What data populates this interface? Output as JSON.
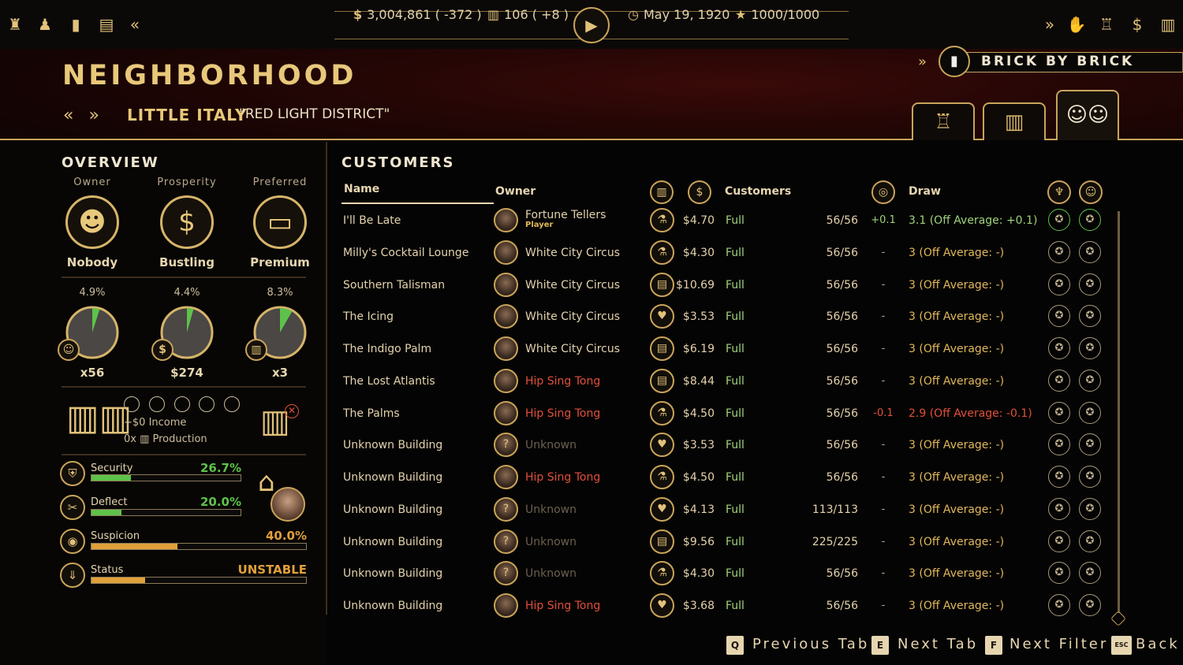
{
  "topbar": {
    "money": "3,004,861 ( -372 )",
    "booze": "106 ( +8 )",
    "date": "May 19, 1920",
    "score": "1000/1000",
    "icons_left": [
      "bodyguard-icon",
      "crew-icon",
      "ledger-icon",
      "briefcase-icon",
      "collapse-left-icon"
    ],
    "icons_right": [
      "expand-right-icon",
      "handshake-icon",
      "city-icon",
      "dollar-icon",
      "booze-crate-icon"
    ]
  },
  "header": {
    "title": "NEIGHBORHOOD",
    "district": "LITTLE ITALY",
    "district_nick": "\"RED LIGHT DISTRICT\"",
    "book": "BRICK BY BRICK"
  },
  "overview": {
    "title": "OVERVIEW",
    "owner_label": "Owner",
    "owner_value": "Nobody",
    "prosperity_label": "Prosperity",
    "prosperity_value": "Bustling",
    "preferred_label": "Preferred",
    "preferred_value": "Premium",
    "gauges": [
      {
        "pct_label": "4.9%",
        "fraction": 0.049,
        "value": "x56",
        "icon": "customers-icon"
      },
      {
        "pct_label": "4.4%",
        "fraction": 0.044,
        "value": "$274",
        "icon": "money-icon"
      },
      {
        "pct_label": "8.3%",
        "fraction": 0.083,
        "value": "x3",
        "icon": "building-icon"
      }
    ],
    "income": "+$0 Income",
    "production": "0x ▥ Production",
    "stats": [
      {
        "label": "Security",
        "value": "26.7%",
        "fraction": 0.267,
        "color": "#5ec24a"
      },
      {
        "label": "Deflect",
        "value": "20.0%",
        "fraction": 0.2,
        "color": "#5ec24a"
      },
      {
        "label": "Suspicion",
        "value": "40.0%",
        "fraction": 0.4,
        "color": "#e0a03a"
      },
      {
        "label": "Status",
        "value": "UNSTABLE",
        "fraction": 0.25,
        "color": "#e0a03a"
      }
    ]
  },
  "customers": {
    "title": "CUSTOMERS",
    "columns": {
      "name": "Name",
      "owner": "Owner",
      "customers": "Customers",
      "draw": "Draw"
    },
    "rows": [
      {
        "name": "I'll Be Late",
        "owner": "Fortune Tellers",
        "sub": "Player",
        "owner_color": "#e3d3ad",
        "price": "$4.70",
        "status": "Full",
        "count": "56/56",
        "mod": "+0.1",
        "mod_color": "#9ed27a",
        "draw": "3.1 (Off Average: +0.1)",
        "draw_color": "#9ed27a"
      },
      {
        "name": "Milly's Cocktail Lounge",
        "owner": "White City Circus",
        "sub": "",
        "owner_color": "#e3d3ad",
        "price": "$4.30",
        "status": "Full",
        "count": "56/56",
        "mod": "-",
        "mod_color": "#bcae8c",
        "draw": "3 (Off Average: -)",
        "draw_color": "#e0b85a"
      },
      {
        "name": "Southern Talisman",
        "owner": "White City Circus",
        "sub": "",
        "owner_color": "#e3d3ad",
        "price": "$10.69",
        "status": "Full",
        "count": "56/56",
        "mod": "-",
        "mod_color": "#bcae8c",
        "draw": "3 (Off Average: -)",
        "draw_color": "#e0b85a"
      },
      {
        "name": "The Icing",
        "owner": "White City Circus",
        "sub": "",
        "owner_color": "#e3d3ad",
        "price": "$3.53",
        "status": "Full",
        "count": "56/56",
        "mod": "-",
        "mod_color": "#bcae8c",
        "draw": "3 (Off Average: -)",
        "draw_color": "#e0b85a"
      },
      {
        "name": "The Indigo Palm",
        "owner": "White City Circus",
        "sub": "",
        "owner_color": "#e3d3ad",
        "price": "$6.19",
        "status": "Full",
        "count": "56/56",
        "mod": "-",
        "mod_color": "#bcae8c",
        "draw": "3 (Off Average: -)",
        "draw_color": "#e0b85a"
      },
      {
        "name": "The Lost Atlantis",
        "owner": "Hip Sing Tong",
        "sub": "",
        "owner_color": "#e0503a",
        "price": "$8.44",
        "status": "Full",
        "count": "56/56",
        "mod": "-",
        "mod_color": "#bcae8c",
        "draw": "3 (Off Average: -)",
        "draw_color": "#e0b85a"
      },
      {
        "name": "The Palms",
        "owner": "Hip Sing Tong",
        "sub": "",
        "owner_color": "#e0503a",
        "price": "$4.50",
        "status": "Full",
        "count": "56/56",
        "mod": "-0.1",
        "mod_color": "#e0503a",
        "draw": "2.9 (Off Average: -0.1)",
        "draw_color": "#e0503a"
      },
      {
        "name": "Unknown Building",
        "owner": "Unknown",
        "sub": "",
        "owner_color": "#6a6050",
        "price": "$3.53",
        "status": "Full",
        "count": "56/56",
        "mod": "-",
        "mod_color": "#bcae8c",
        "draw": "3 (Off Average: -)",
        "draw_color": "#e0b85a"
      },
      {
        "name": "Unknown Building",
        "owner": "Hip Sing Tong",
        "sub": "",
        "owner_color": "#e0503a",
        "price": "$4.50",
        "status": "Full",
        "count": "56/56",
        "mod": "-",
        "mod_color": "#bcae8c",
        "draw": "3 (Off Average: -)",
        "draw_color": "#e0b85a"
      },
      {
        "name": "Unknown Building",
        "owner": "Unknown",
        "sub": "",
        "owner_color": "#6a6050",
        "price": "$4.13",
        "status": "Full",
        "count": "113/113",
        "mod": "-",
        "mod_color": "#bcae8c",
        "draw": "3 (Off Average: -)",
        "draw_color": "#e0b85a"
      },
      {
        "name": "Unknown Building",
        "owner": "Unknown",
        "sub": "",
        "owner_color": "#6a6050",
        "price": "$9.56",
        "status": "Full",
        "count": "225/225",
        "mod": "-",
        "mod_color": "#bcae8c",
        "draw": "3 (Off Average: -)",
        "draw_color": "#e0b85a"
      },
      {
        "name": "Unknown Building",
        "owner": "Unknown",
        "sub": "",
        "owner_color": "#6a6050",
        "price": "$4.30",
        "status": "Full",
        "count": "56/56",
        "mod": "-",
        "mod_color": "#bcae8c",
        "draw": "3 (Off Average: -)",
        "draw_color": "#e0b85a"
      },
      {
        "name": "Unknown Building",
        "owner": "Hip Sing Tong",
        "sub": "",
        "owner_color": "#e0503a",
        "price": "$3.68",
        "status": "Full",
        "count": "56/56",
        "mod": "-",
        "mod_color": "#bcae8c",
        "draw": "3 (Off Average: -)",
        "draw_color": "#e0b85a"
      }
    ]
  },
  "footer": {
    "prev_key": "Q",
    "prev_label": "Previous Tab",
    "next_key": "E",
    "next_label": "Next Tab",
    "filter_key": "F",
    "filter_label": "Next Filter",
    "back_key": "ESC",
    "back_label": "Back"
  }
}
